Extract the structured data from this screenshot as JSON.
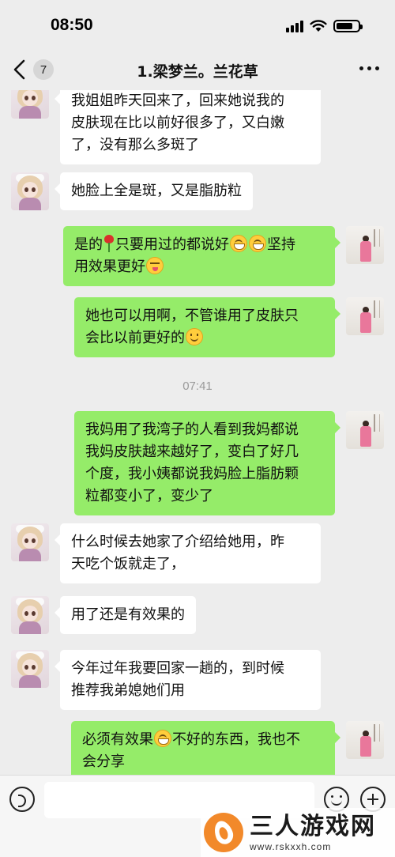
{
  "status_bar": {
    "time": "08:50"
  },
  "nav": {
    "unread_count": "7",
    "title": "1.梁梦兰。兰花草"
  },
  "timestamp": "07:41",
  "messages": [
    {
      "side": "left",
      "lines": [
        "我姐姐昨天回来了，回来她说我的",
        "皮肤现在比以前好很多了，又白嫩",
        "了，没有那么多斑了"
      ]
    },
    {
      "side": "left",
      "lines": [
        "她脸上全是斑，又是脂肪粒"
      ]
    },
    {
      "side": "right",
      "line1_a": "是的",
      "line1_b": "只要用过的都说好",
      "line1_c": "坚持",
      "line2_a": "用效果更好"
    },
    {
      "side": "right",
      "line1": "她也可以用啊，不管谁用了皮肤只",
      "line2_a": "会比以前更好的"
    },
    {
      "side": "right",
      "lines": [
        "我妈用了我湾子的人看到我妈都说",
        "我妈皮肤越来越好了，变白了好几",
        "个度，我小姨都说我妈脸上脂肪颗",
        "粒都变小了，变少了"
      ]
    },
    {
      "side": "left",
      "lines": [
        "什么时候去她家了介绍给她用，昨",
        "天吃个饭就走了，"
      ]
    },
    {
      "side": "left",
      "lines": [
        "用了还是有效果的"
      ]
    },
    {
      "side": "left",
      "lines": [
        "今年过年我要回家一趟的，到时候",
        "推荐我弟媳她们用"
      ]
    },
    {
      "side": "right",
      "line1_a": "必须有效果",
      "line1_b": "不好的东西，我也不",
      "line2": "会分享"
    }
  ],
  "input": {
    "placeholder": ""
  },
  "watermark": {
    "title": "三人游戏网",
    "url": "www.rskxxh.com"
  },
  "icons": {
    "back": "chevron-left-icon",
    "more": "more-dots-icon",
    "voice": "voice-icon",
    "emoji": "emoji-icon",
    "plus": "plus-icon",
    "signal": "signal-icon",
    "wifi": "wifi-icon",
    "battery": "battery-icon"
  },
  "colors": {
    "background": "#ededed",
    "bubble_self": "#95ec69",
    "bubble_other": "#ffffff"
  }
}
